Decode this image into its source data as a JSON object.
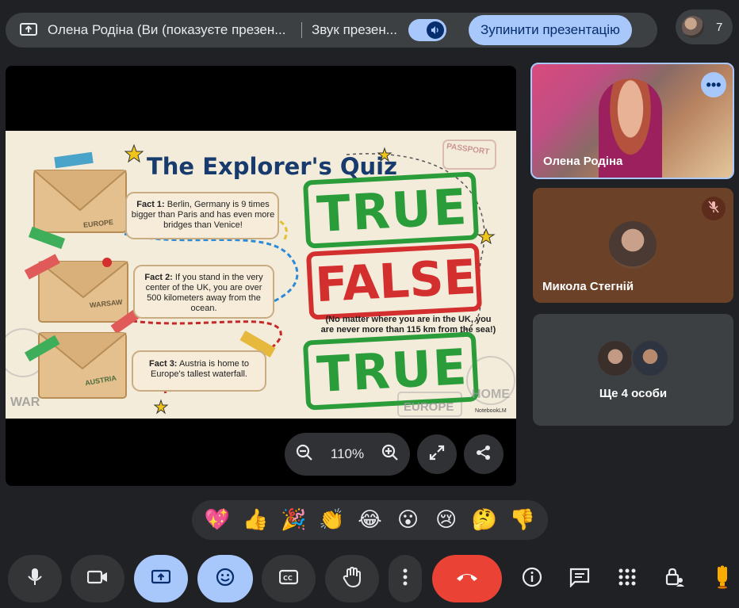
{
  "presenting_bar": {
    "presenter_text": "Олена Родіна (Ви (показуєте презен...",
    "sound_label": "Звук презен...",
    "stop_button": "Зупинити презентацію"
  },
  "participants": {
    "count": "7"
  },
  "slide": {
    "title": "The Explorer's Quiz",
    "facts": [
      {
        "label": "Fact 1:",
        "text": "Berlin, Germany is 9 times bigger than Paris and has even more bridges than Venice!",
        "stamp": "EUROPE",
        "answer": "TRUE",
        "answer_color": "#2a9d3a"
      },
      {
        "label": "Fact 2:",
        "text": "If you stand in the very center of the UK, you are over 500 kilometers away from the ocean.",
        "stamp": "WARSAW",
        "answer": "FALSE",
        "answer_color": "#d32f2f"
      },
      {
        "label": "Fact 3:",
        "text": "Austria is home to Europe's tallest waterfall.",
        "stamp": "AUSTRIA",
        "answer": "TRUE",
        "answer_color": "#2a9d3a"
      }
    ],
    "note": "(No matter where you are in the UK, you are never more than 115 km from the sea!)",
    "watermark": "NotebookLM",
    "stamps": [
      "PASSPORT",
      "HOME",
      "EUROPE",
      "WAR"
    ]
  },
  "zoom": {
    "value": "110%"
  },
  "tiles": [
    {
      "name": "Олена Родіна"
    },
    {
      "name": "Микола Стегній"
    },
    {
      "name": "Ще 4 особи"
    }
  ],
  "reactions": [
    "💖",
    "👍",
    "🎉",
    "👏",
    "😂",
    "😮",
    "😢",
    "🤔",
    "👎"
  ],
  "colors": {
    "accent": "#a8c7fa",
    "end_call": "#ea4335",
    "background": "#202124"
  }
}
